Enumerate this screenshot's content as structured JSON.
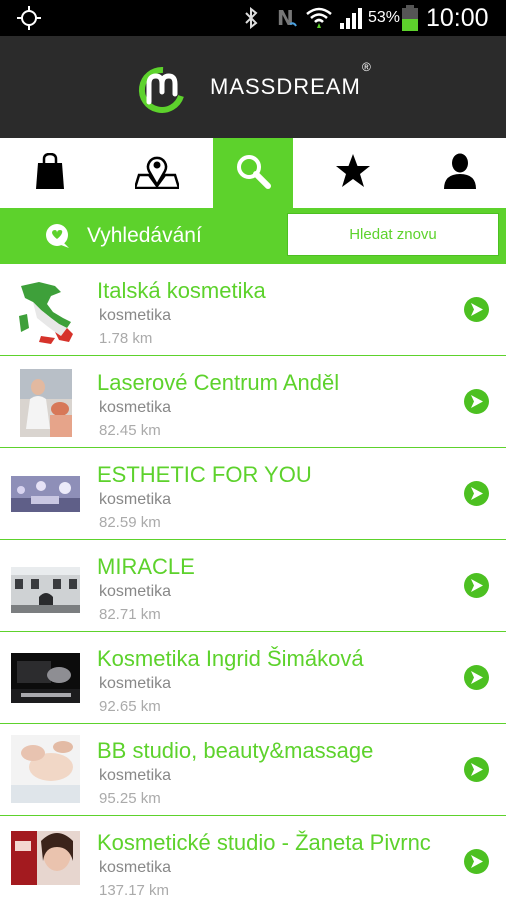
{
  "status_bar": {
    "battery_percent": "53%",
    "time": "10:00",
    "icons": [
      "location-target-icon",
      "bluetooth-icon",
      "nfc-icon",
      "wifi-icon",
      "signal-icon",
      "battery-icon"
    ],
    "battery_level": 0.53
  },
  "header": {
    "brand": "MASSDREAM",
    "registered_mark": "®",
    "brand_color": "#5dd22c"
  },
  "tabs": [
    {
      "icon": "shopping-bag-icon",
      "active": false
    },
    {
      "icon": "map-pin-icon",
      "active": false
    },
    {
      "icon": "search-icon",
      "active": true
    },
    {
      "icon": "star-icon",
      "active": false
    },
    {
      "icon": "user-icon",
      "active": false
    }
  ],
  "search_bar": {
    "title": "Vyhledávání",
    "again_button": "Hledat znovu"
  },
  "results": [
    {
      "title": "Italská kosmetika",
      "category": "kosmetika",
      "distance": "1.78 km",
      "thumb": "italy-map"
    },
    {
      "title": "Laserové Centrum Anděl",
      "category": "kosmetika",
      "distance": "82.45 km",
      "thumb": "clinic-photo"
    },
    {
      "title": "ESTHETIC FOR YOU",
      "category": "kosmetika",
      "distance": "82.59 km",
      "thumb": "salon-interior"
    },
    {
      "title": "MIRACLE",
      "category": "kosmetika",
      "distance": "82.71 km",
      "thumb": "building-photo"
    },
    {
      "title": "Kosmetika Ingrid Šimáková",
      "category": "kosmetika",
      "distance": "92.65 km",
      "thumb": "product-box"
    },
    {
      "title": "BB studio, beauty&massage",
      "category": "kosmetika",
      "distance": "95.25 km",
      "thumb": "facial-photo"
    },
    {
      "title": "Kosmetické studio - Žaneta Pivrnc",
      "category": "kosmetika",
      "distance": "137.17 km",
      "thumb": "woman-portrait"
    }
  ],
  "colors": {
    "accent": "#5dd22c",
    "header_bg": "#2b2b2b",
    "statusbar_bg": "#000000"
  }
}
